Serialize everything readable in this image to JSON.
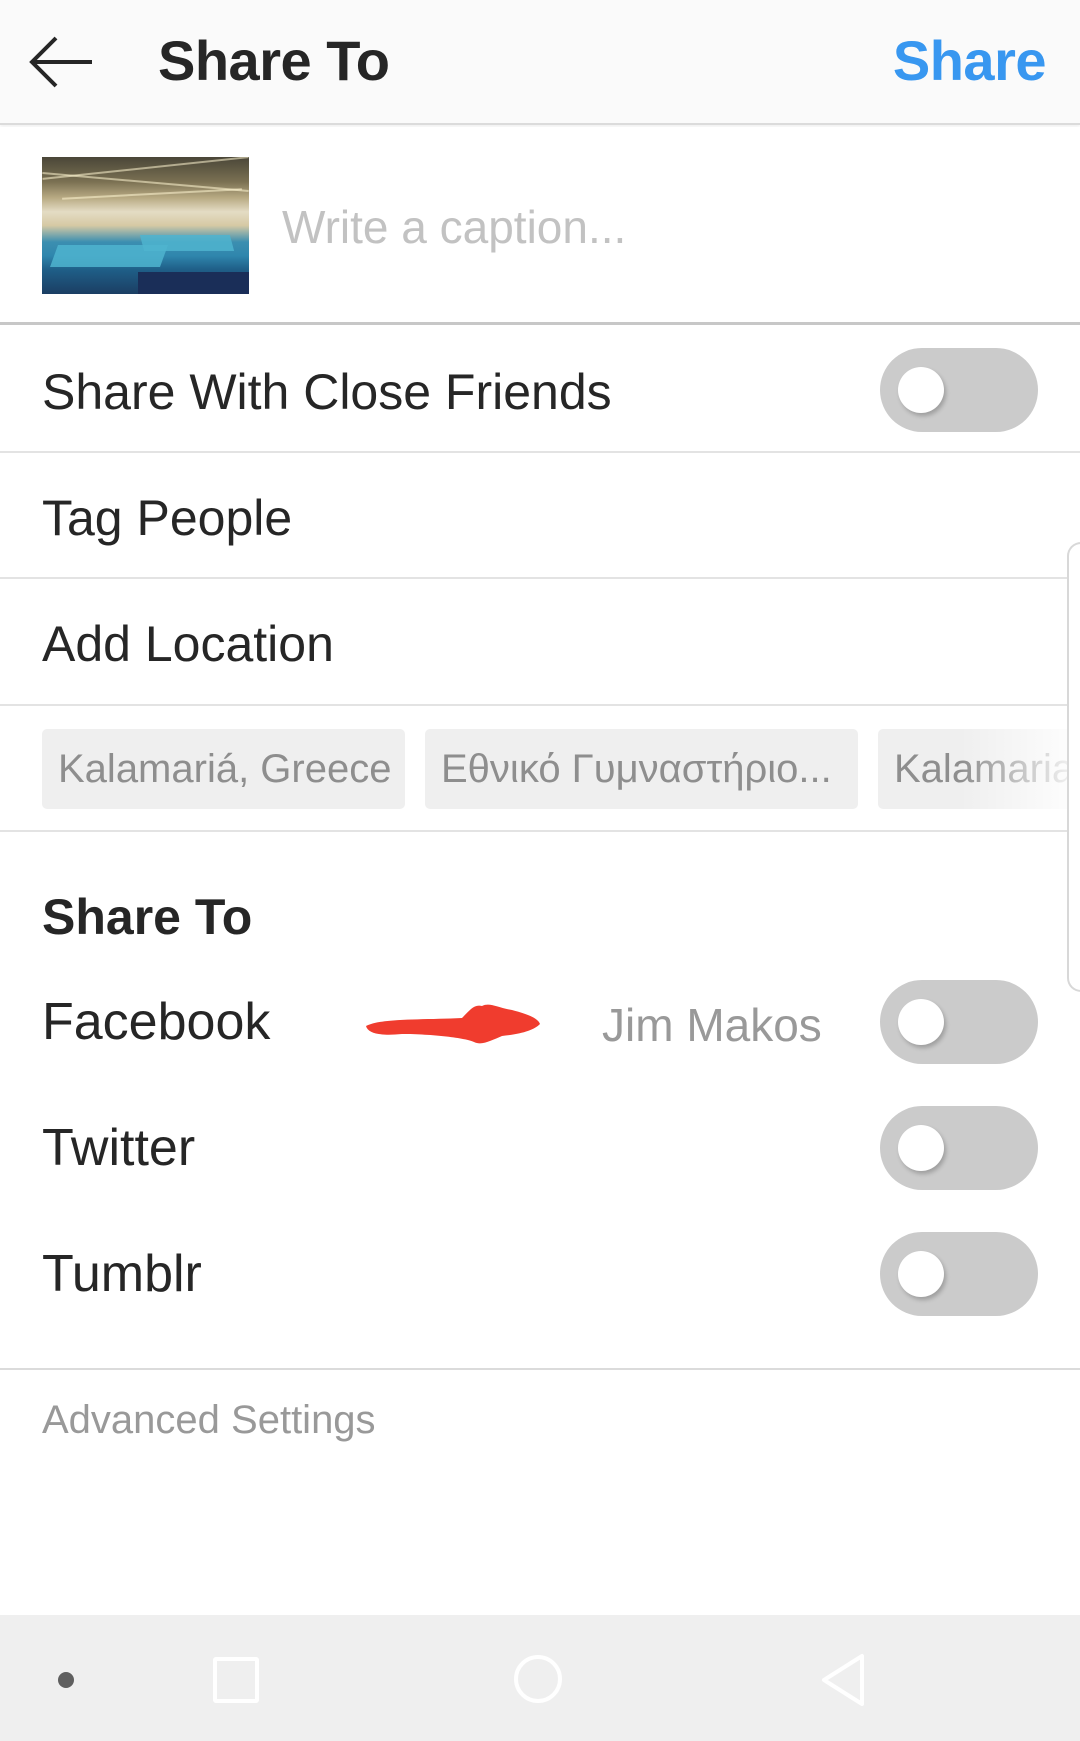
{
  "header": {
    "title": "Share To",
    "share_label": "Share",
    "back_icon": "arrow-left-icon",
    "accent_color": "#3897f0"
  },
  "caption": {
    "placeholder": "Write a caption...",
    "value": "",
    "thumbnail_alt": "Indoor gymnasium photo"
  },
  "options": {
    "close_friends": {
      "label": "Share With Close Friends",
      "enabled": false
    },
    "tag_people": {
      "label": "Tag People"
    },
    "add_location": {
      "label": "Add Location"
    }
  },
  "location_suggestions": [
    {
      "label": "Kalamariá, Greece"
    },
    {
      "label": "Εθνικό Γυμναστήριο..."
    },
    {
      "label": "Kalamaria"
    }
  ],
  "share_to": {
    "title": "Share To",
    "targets": [
      {
        "label": "Facebook",
        "account": "Jim Makos",
        "enabled": false
      },
      {
        "label": "Twitter",
        "enabled": false
      },
      {
        "label": "Tumblr",
        "enabled": false
      }
    ],
    "annotation": "red-arrow-icon",
    "annotation_color": "#f03c2e"
  },
  "advanced_settings": {
    "label": "Advanced Settings"
  },
  "nav_bar": {
    "icons": [
      "dot-icon",
      "recents-square-icon",
      "home-circle-icon",
      "back-triangle-icon"
    ]
  }
}
